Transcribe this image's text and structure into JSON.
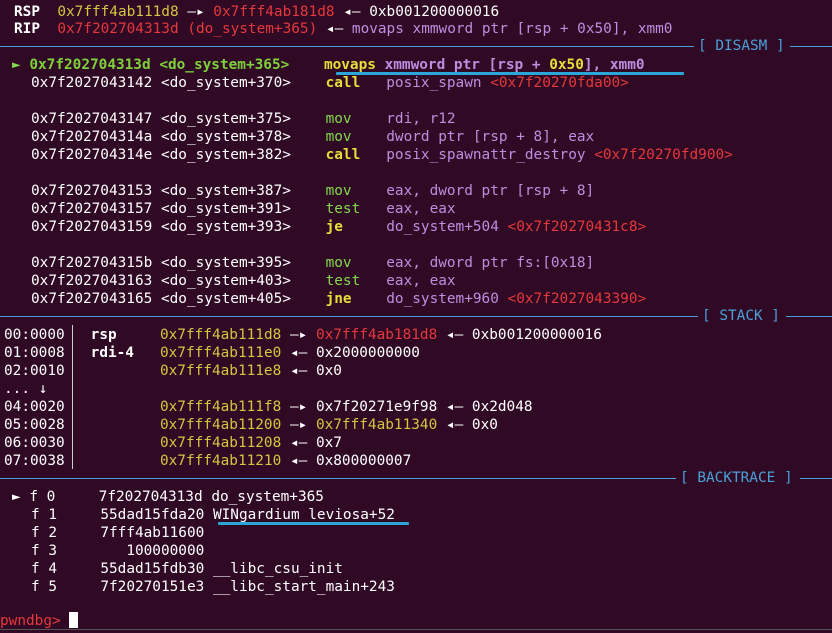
{
  "regs": {
    "rsp_name": "RSP",
    "rsp_addr1": "0x7fff4ab111d8",
    "rsp_arrow1": " —▸ ",
    "rsp_addr2": "0x7fff4ab181d8",
    "rsp_arrow2": " ◂— ",
    "rsp_val": "0xb001200000016",
    "rip_name": "RIP",
    "rip_addr": "0x7f202704313d (do_system+365)",
    "rip_arrow": " ◂— ",
    "rip_op": "movaps",
    "rip_args": " xmmword ptr [rsp + 0x50], xmm0"
  },
  "headers": {
    "disasm": "[ DISASM ]",
    "stack": "[ STACK ]",
    "backtrace": "[ BACKTRACE ]"
  },
  "disasm": {
    "current_marker": "►",
    "current": {
      "addr": "0x7f202704313d",
      "sym": "<do_system+365>",
      "op": "movaps",
      "a1": "xmmword ptr [rsp + ",
      "a2": "0x50",
      "a3": "], xmm0"
    },
    "l2": {
      "addr": "0x7f2027043142",
      "sym": "<do_system+370>",
      "op": "call",
      "a1": "posix_spawn ",
      "a2": "<0x7f20270fda00>"
    },
    "l3": {
      "addr": "0x7f2027043147",
      "sym": "<do_system+375>",
      "op": "mov",
      "a1": "rdi, r12"
    },
    "l4": {
      "addr": "0x7f202704314a",
      "sym": "<do_system+378>",
      "op": "mov",
      "a1": "dword ptr [rsp + 8], eax"
    },
    "l5": {
      "addr": "0x7f202704314e",
      "sym": "<do_system+382>",
      "op": "call",
      "a1": "posix_spawnattr_destroy ",
      "a2": "<0x7f20270fd900>"
    },
    "l6": {
      "addr": "0x7f2027043153",
      "sym": "<do_system+387>",
      "op": "mov",
      "a1": "eax, dword ptr [rsp + 8]"
    },
    "l7": {
      "addr": "0x7f2027043157",
      "sym": "<do_system+391>",
      "op": "test",
      "a1": "eax, eax"
    },
    "l8": {
      "addr": "0x7f2027043159",
      "sym": "<do_system+393>",
      "op": "je",
      "a1": "do_system+504 ",
      "a2": "<0x7f20270431c8>"
    },
    "l9": {
      "addr": "0x7f202704315b",
      "sym": "<do_system+395>",
      "op": "mov",
      "a1": "eax, dword ptr fs:[0x18]"
    },
    "l10": {
      "addr": "0x7f2027043163",
      "sym": "<do_system+403>",
      "op": "test",
      "a1": "eax, eax"
    },
    "l11": {
      "addr": "0x7f2027043165",
      "sym": "<do_system+405>",
      "op": "jne",
      "a1": "do_system+960 ",
      "a2": "<0x7f2027043390>"
    }
  },
  "stack": {
    "arrow_r": "—▸",
    "arrow_l": "◂—",
    "s0": {
      "idx": "00:0000",
      "reg": "rsp",
      "addr": "0x7fff4ab111d8",
      "p1": "0x7fff4ab181d8",
      "v": "0xb001200000016"
    },
    "s1": {
      "idx": "01:0008",
      "reg": "rdi-4",
      "addr": "0x7fff4ab111e0",
      "v": "0x2000000000"
    },
    "s2": {
      "idx": "02:0010",
      "addr": "0x7fff4ab111e8",
      "v": "0x0"
    },
    "skip": "... ↓",
    "s4": {
      "idx": "04:0020",
      "addr": "0x7fff4ab111f8",
      "p1": "0x7f20271e9f98",
      "v": "0x2d048"
    },
    "s5": {
      "idx": "05:0028",
      "addr": "0x7fff4ab11200",
      "p1": "0x7fff4ab11340",
      "v": "0x0"
    },
    "s6": {
      "idx": "06:0030",
      "addr": "0x7fff4ab11208",
      "v": "0x7"
    },
    "s7": {
      "idx": "07:0038",
      "addr": "0x7fff4ab11210",
      "v": "0x800000007"
    }
  },
  "backtrace": {
    "marker": "►",
    "f0": {
      "f": "f 0",
      "addr": "7f202704313d",
      "sym": "do_system+365"
    },
    "f1": {
      "f": "f 1",
      "addr": "55dad15fda20",
      "sym": "WINgardium_leviosa+52"
    },
    "f2": {
      "f": "f 2",
      "addr": "7fff4ab11600",
      "sym": ""
    },
    "f3": {
      "f": "f 3",
      "addr": "100000000",
      "sym": ""
    },
    "f4": {
      "f": "f 4",
      "addr": "55dad15fdb30",
      "sym": "__libc_csu_init"
    },
    "f5": {
      "f": "f 5",
      "addr": "7f20270151e3",
      "sym": "__libc_start_main+243"
    }
  },
  "prompt": {
    "text": "pwndbg>",
    "input": " "
  },
  "colors": {
    "background": "#300a24",
    "address": "#d7c441",
    "pointer": "#e5383b",
    "instruction_args": "#b98fe0",
    "mnemonic": "#82d84e",
    "section_header": "#4aa0d8",
    "highlight_marker": "#2aa7d8"
  }
}
